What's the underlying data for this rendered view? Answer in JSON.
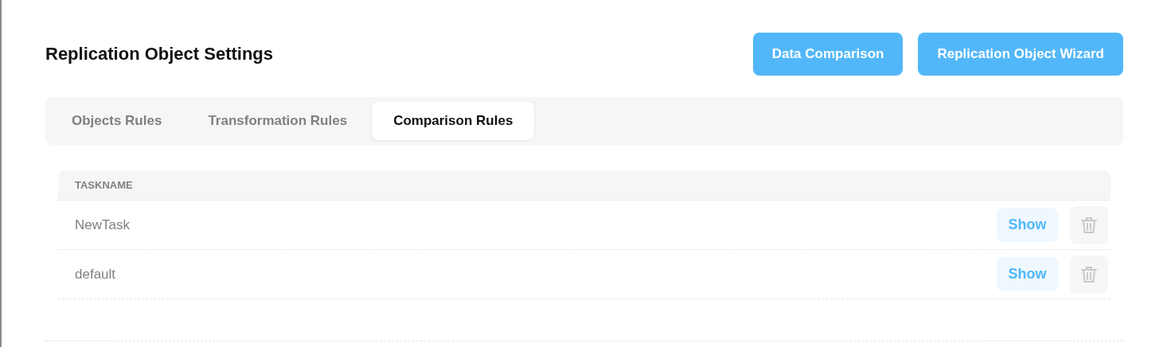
{
  "header": {
    "title": "Replication Object Settings",
    "buttons": [
      "Data Comparison",
      "Replication Object Wizard"
    ]
  },
  "tabs": [
    {
      "label": "Objects Rules",
      "selected": false
    },
    {
      "label": "Transformation Rules",
      "selected": false
    },
    {
      "label": "Comparison Rules",
      "selected": true
    }
  ],
  "table": {
    "columns": [
      "TASKNAME"
    ],
    "rows": [
      {
        "taskname": "NewTask",
        "action": "Show"
      },
      {
        "taskname": "default",
        "action": "Show"
      }
    ]
  }
}
